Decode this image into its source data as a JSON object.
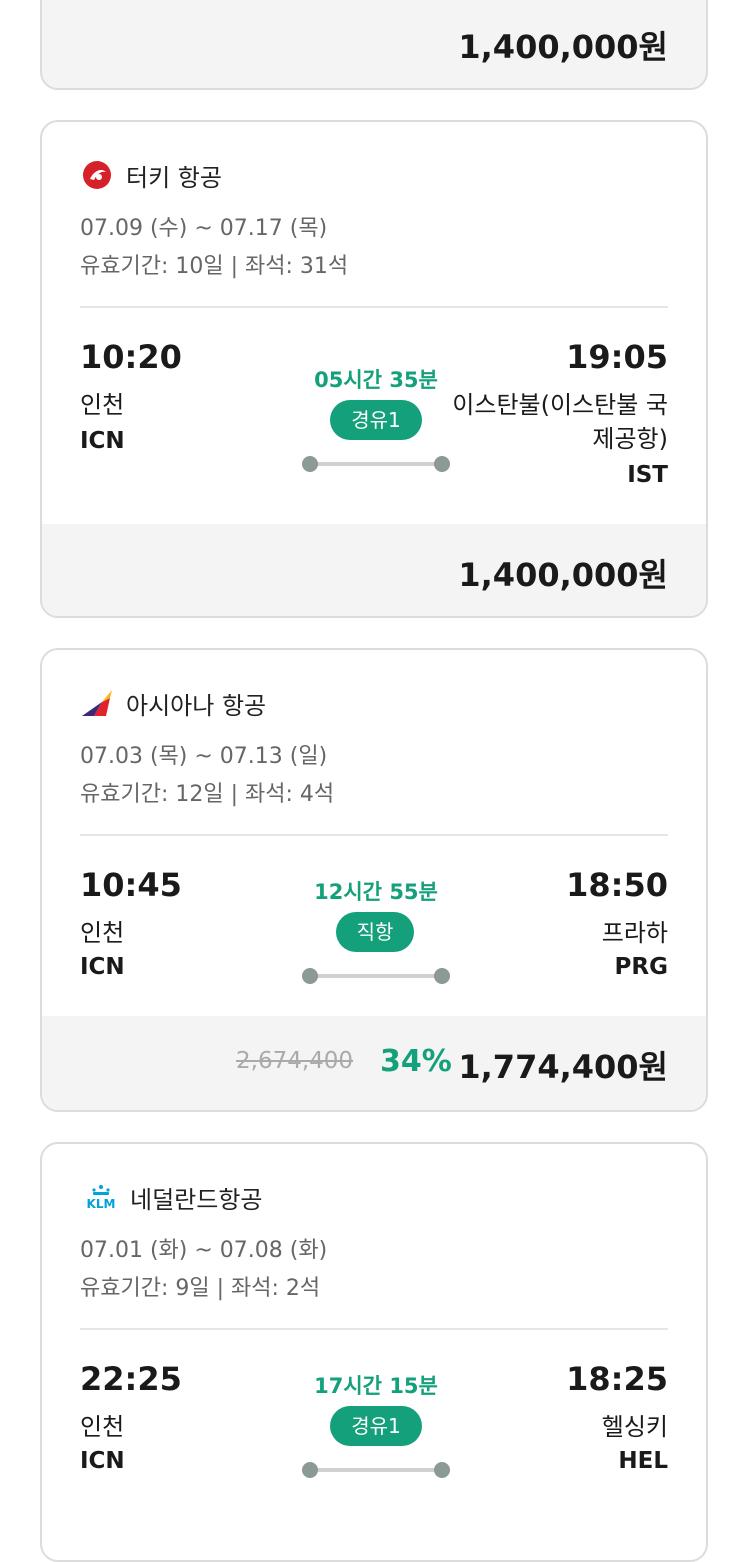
{
  "top_card": {
    "price": "1,400,000원"
  },
  "cards": [
    {
      "airline": "터키 항공",
      "logo": "turkish-airlines-logo",
      "dates": "07.09 (수) ~ 07.17 (목)",
      "meta": "유효기간: 10일 | 좌석: 31석",
      "depart_time": "10:20",
      "depart_city": "인천",
      "depart_code": "ICN",
      "duration": "05시간 35분",
      "stops": "경유1",
      "arrive_time": "19:05",
      "arrive_city_line1": "이스탄불(이스탄불 국",
      "arrive_city_line2": "제공항)",
      "arrive_code": "IST",
      "price": "1,400,000원"
    },
    {
      "airline": "아시아나 항공",
      "logo": "asiana-airlines-logo",
      "dates": "07.03 (목) ~ 07.13 (일)",
      "meta": "유효기간: 12일 | 좌석: 4석",
      "depart_time": "10:45",
      "depart_city": "인천",
      "depart_code": "ICN",
      "duration": "12시간 55분",
      "stops": "직항",
      "arrive_time": "18:50",
      "arrive_city": "프라하",
      "arrive_code": "PRG",
      "original_price": "2,674,400",
      "discount": "34%",
      "price": "1,774,400원"
    },
    {
      "airline": "네덜란드항공",
      "logo": "klm-logo",
      "logo_text": "KLM",
      "dates": "07.01 (화) ~ 07.08 (화)",
      "meta": "유효기간: 9일 | 좌석: 2석",
      "depart_time": "22:25",
      "depart_city": "인천",
      "depart_code": "ICN",
      "duration": "17시간 15분",
      "stops": "경유1",
      "arrive_time": "18:25",
      "arrive_city": "헬싱키",
      "arrive_code": "HEL"
    }
  ],
  "colors": {
    "accent": "#14a07a",
    "text": "#1a1a1a",
    "muted": "#666666",
    "price_bg": "#f4f4f4"
  }
}
